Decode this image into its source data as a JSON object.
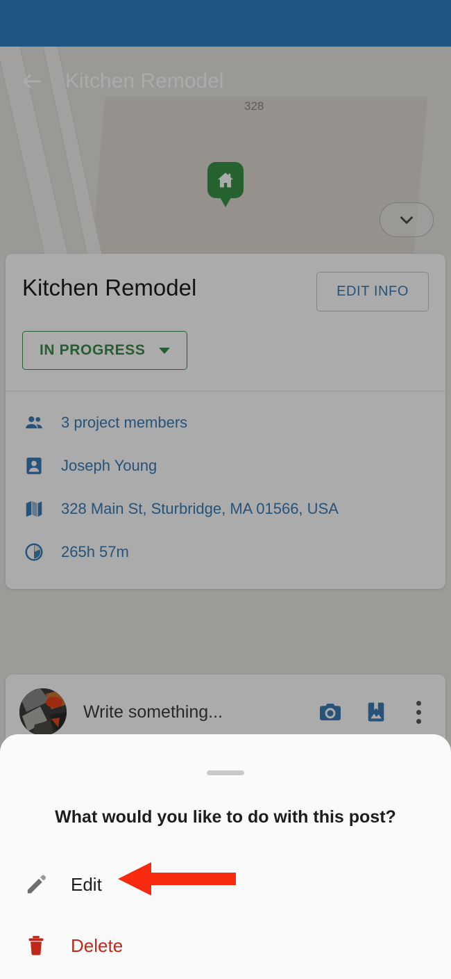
{
  "status_bar": {
    "color": "#1f5582"
  },
  "app_bar": {
    "title": "Kitchen Remodel",
    "back_icon": "arrow-left-icon"
  },
  "map": {
    "house_marker_icon": "home-marker-icon",
    "marker_color": "#3a9248",
    "street_number_label": "328",
    "collapse_icon": "chevron-down-icon"
  },
  "project_card": {
    "title": "Kitchen Remodel",
    "edit_info_label": "EDIT INFO",
    "edit_info_color": "#3b7cb5",
    "status_label": "IN PROGRESS",
    "status_color": "#3b8b4c",
    "status_caret_icon": "caret-down-icon",
    "info_rows": [
      {
        "icon": "people-icon",
        "text": "3 project members"
      },
      {
        "icon": "contact-card-icon",
        "text": "Joseph Young"
      },
      {
        "icon": "map-icon",
        "text": "328 Main St, Sturbridge, MA 01566, USA"
      },
      {
        "icon": "clock-icon",
        "text": "265h 57m"
      }
    ],
    "info_text_color": "#3b7cb5"
  },
  "compose_bar": {
    "avatar_icon": "user-avatar",
    "placeholder": "Write something...",
    "camera_icon": "camera-icon",
    "photo_icon": "saved-photo-icon",
    "more_icon": "more-vertical-icon",
    "icon_color": "#3b7cb5"
  },
  "bottom_sheet": {
    "handle_icon": "drag-handle",
    "title": "What would you like to do with this post?",
    "items": [
      {
        "icon": "pencil-icon",
        "label": "Edit",
        "color": "#1d1d1d"
      },
      {
        "icon": "trash-icon",
        "label": "Delete",
        "color": "#c0281c"
      }
    ]
  },
  "annotation": {
    "arrow_icon": "left-arrow-annotation",
    "color": "#f82b10",
    "points_at": "Edit"
  }
}
